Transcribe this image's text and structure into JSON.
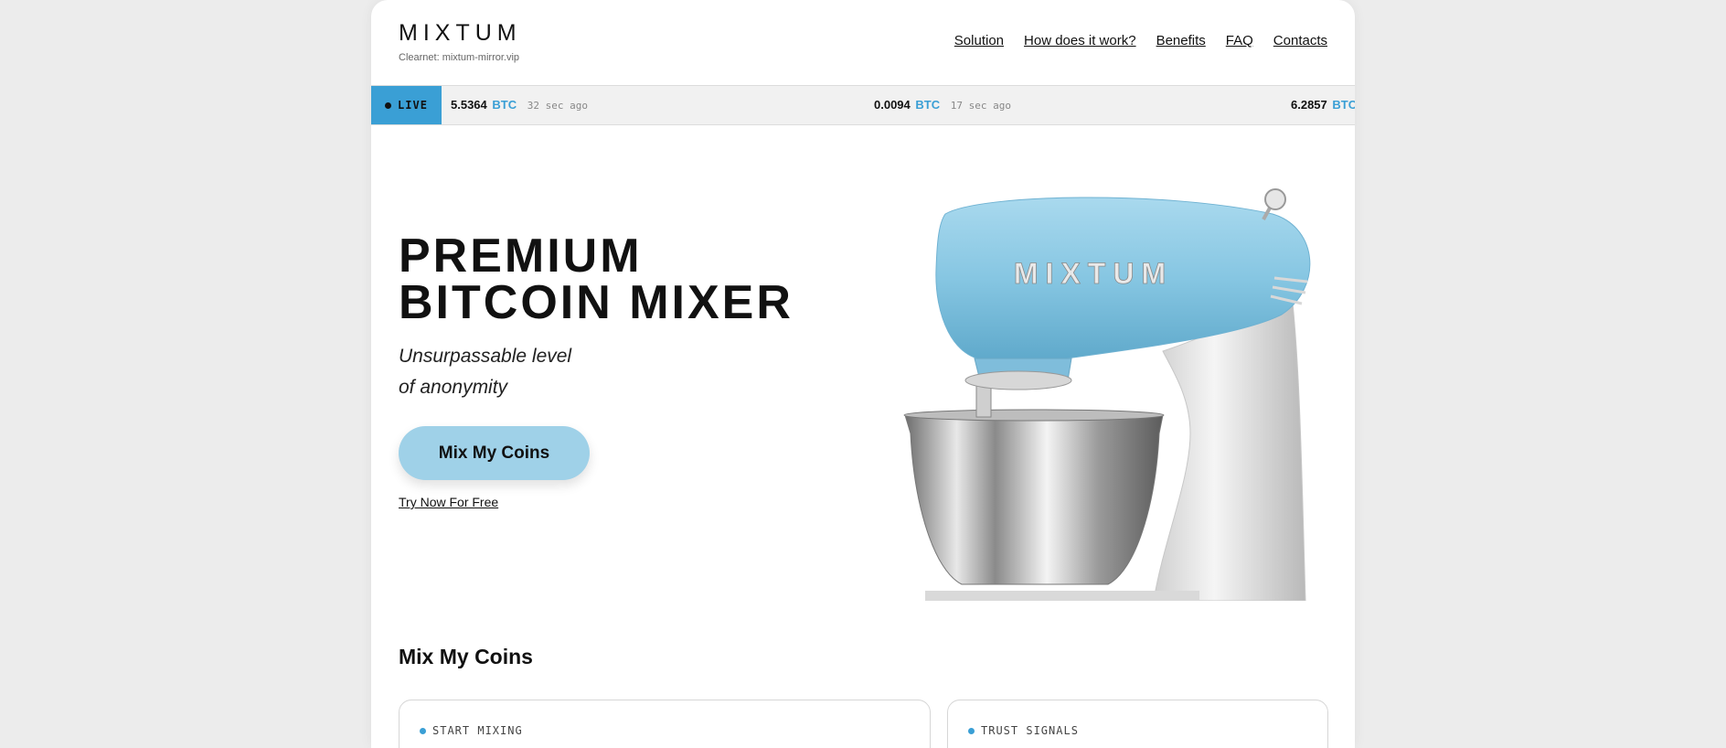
{
  "header": {
    "logo": "MIXTUM",
    "clearnet": "Clearnet: mixtum-mirror.vip",
    "nav": [
      "Solution",
      "How does it work?",
      "Benefits",
      "FAQ",
      "Contacts"
    ]
  },
  "ticker": {
    "live_label": "LIVE",
    "items": [
      {
        "amount": "5.5364",
        "unit": "BTC",
        "time": "32 sec ago"
      },
      {
        "amount": "0.0094",
        "unit": "BTC",
        "time": "17 sec ago"
      },
      {
        "amount": "6.2857",
        "unit": "BTC",
        "time": ""
      }
    ]
  },
  "hero": {
    "title_line1": "PREMIUM",
    "title_line2": "BITCOIN MIXER",
    "subtitle_line1": "Unsurpassable level",
    "subtitle_line2": "of anonymity",
    "cta_label": "Mix My Coins",
    "try_label": "Try Now For Free",
    "mixer_brand": "MIXTUM"
  },
  "section": {
    "title": "Mix My Coins",
    "cards": [
      {
        "label": "START MIXING"
      },
      {
        "label": "TRUST SIGNALS"
      }
    ]
  },
  "colors": {
    "accent": "#3a9fd5",
    "cta": "#9fd1e8",
    "mixer_body": "#8ecbe4",
    "background": "#ececec"
  }
}
